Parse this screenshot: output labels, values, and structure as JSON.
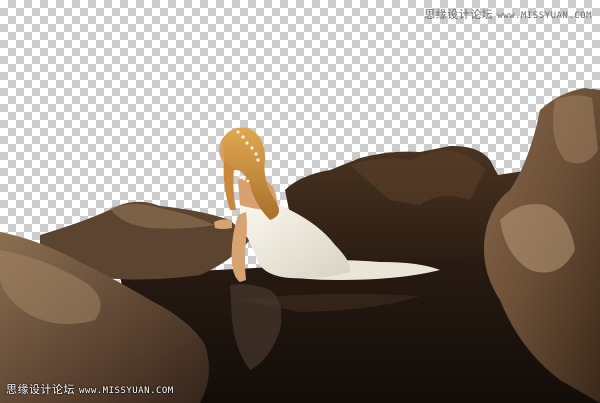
{
  "canvas": {
    "background": "transparency-checkerboard",
    "checker_colors": [
      "#ffffff",
      "#cccccc"
    ]
  },
  "watermark_top": {
    "text": "思缘设计论坛",
    "url": "www.MISSYUAN.COM"
  },
  "watermark_bottom": {
    "text": "思缘设计论坛",
    "url": "www.MISSYUAN.COM"
  },
  "image": {
    "subject": "woman in white dress kneeling in dark water between rocks",
    "colors": {
      "rock_dark": "#3b2a1c",
      "rock_mid": "#6b5038",
      "rock_light": "#a98a6a",
      "water": "#1e140e",
      "dress": "#f1ece0",
      "hair": "#c88a3a",
      "skin": "#d9a070"
    }
  }
}
